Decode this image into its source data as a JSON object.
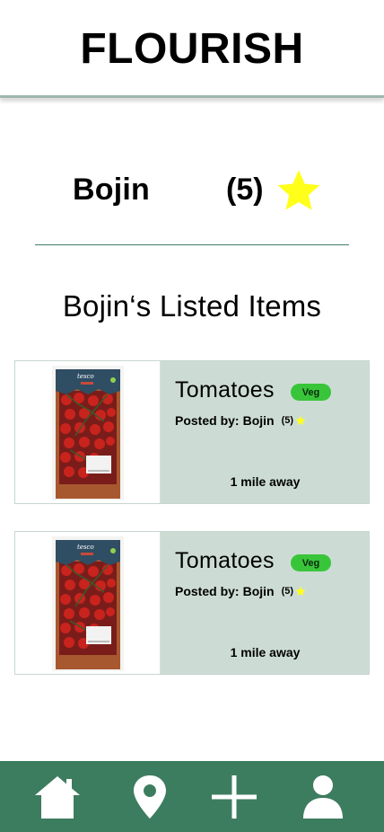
{
  "app": {
    "title": "FLOURISH"
  },
  "profile": {
    "name": "Bojin",
    "rating": "(5)",
    "star_color": "#ffff1a"
  },
  "listings": {
    "title": "Bojin‘s Listed Items",
    "items": [
      {
        "name": "Tomatoes",
        "tag": "Veg",
        "posted_label": "Posted by:",
        "poster": "Bojin",
        "poster_rating": "(5)",
        "distance": "1 mile away"
      },
      {
        "name": "Tomatoes",
        "tag": "Veg",
        "posted_label": "Posted by:",
        "poster": "Bojin",
        "poster_rating": "(5)",
        "distance": "1 mile away"
      }
    ]
  },
  "nav": {
    "items": [
      {
        "icon": "home-icon"
      },
      {
        "icon": "location-pin-icon"
      },
      {
        "icon": "plus-icon"
      },
      {
        "icon": "user-icon"
      }
    ]
  },
  "colors": {
    "nav_bg": "#3d7d5f",
    "card_bg": "#ccdcd4",
    "badge_bg": "#39c53a",
    "divider": "#3f7d6a"
  }
}
